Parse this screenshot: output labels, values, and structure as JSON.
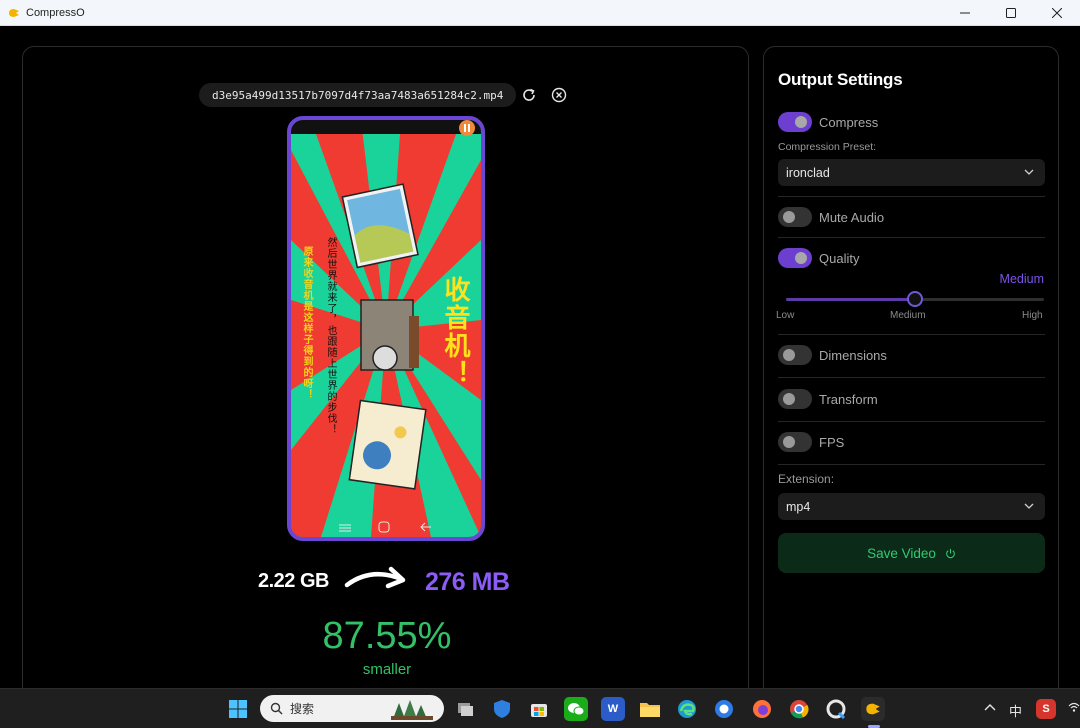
{
  "window": {
    "title": "CompressO"
  },
  "preview": {
    "filename": "d3e95a499d13517b7097d4f73aa7483a651284c2.mp4",
    "video_title": "收音机！",
    "video_text_line1": "然后世界就来了，也跟随上世界的步伐！",
    "video_text_line2": "原来收音机是这样子得到的呀！",
    "original_size": "2.22 GB",
    "compressed_size": "276 MB",
    "reduction_percent": "87.55%",
    "reduction_label": "smaller"
  },
  "settings": {
    "title": "Output Settings",
    "compress": {
      "label": "Compress",
      "enabled": true
    },
    "preset": {
      "label": "Compression Preset:",
      "value": "ironclad"
    },
    "mute_audio": {
      "label": "Mute Audio",
      "enabled": false
    },
    "quality": {
      "label": "Quality",
      "enabled": true,
      "value": "Medium",
      "level": 0.5,
      "ticks": [
        "Low",
        "Medium",
        "High"
      ]
    },
    "dimensions": {
      "label": "Dimensions",
      "enabled": false
    },
    "transform": {
      "label": "Transform",
      "enabled": false
    },
    "fps": {
      "label": "FPS",
      "enabled": false
    },
    "extension": {
      "label": "Extension:",
      "value": "mp4"
    },
    "save_label": "Save Video"
  },
  "taskbar": {
    "search_placeholder": "搜索",
    "ime": "中",
    "apps": [
      "windows-start",
      "search",
      "task-view",
      "security",
      "store",
      "wechat",
      "word",
      "file-explorer",
      "edge",
      "app-blue",
      "firefox",
      "chrome",
      "qq-browser",
      "compresso"
    ]
  },
  "colors": {
    "accent": "#6d3fd0",
    "success": "#33c167",
    "compressed_size": "#8b5cf6"
  }
}
